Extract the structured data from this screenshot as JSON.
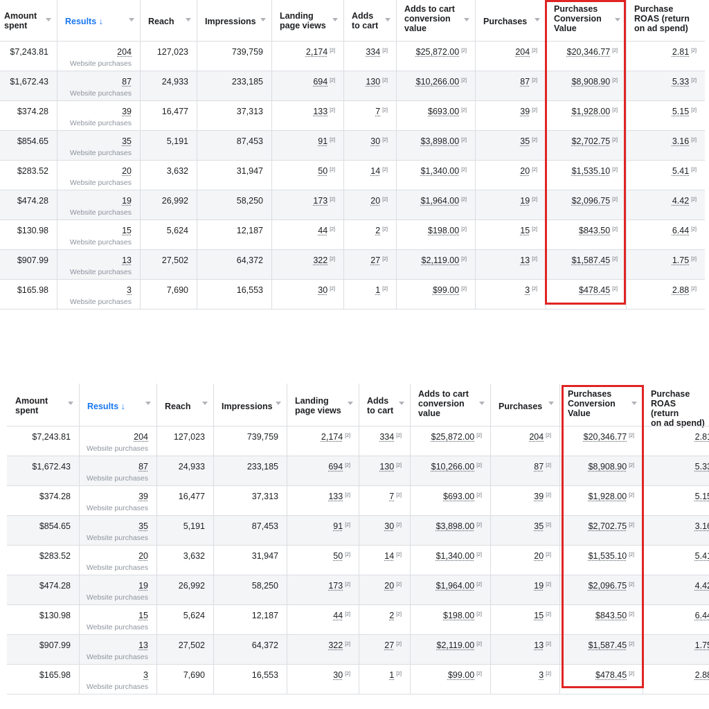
{
  "columns": [
    {
      "key": "amount",
      "label_lines": [
        "Amount",
        "spent"
      ]
    },
    {
      "key": "results",
      "label_lines": [
        "Results ↓"
      ]
    },
    {
      "key": "reach",
      "label_lines": [
        "Reach"
      ]
    },
    {
      "key": "impressions",
      "label_lines": [
        "Impressions"
      ]
    },
    {
      "key": "landing",
      "label_lines": [
        "Landing",
        "page views"
      ]
    },
    {
      "key": "atc",
      "label_lines": [
        "Adds",
        "to cart"
      ]
    },
    {
      "key": "atcv",
      "label_lines": [
        "Adds to cart",
        "conversion",
        "value"
      ]
    },
    {
      "key": "purchases",
      "label_lines": [
        "Purchases"
      ]
    },
    {
      "key": "pcv",
      "label_lines": [
        "Purchases",
        "Conversion",
        "Value"
      ]
    },
    {
      "key": "roas",
      "label_lines": [
        "Purchase",
        "ROAS (return",
        "on ad spend)"
      ]
    }
  ],
  "results_sublabel": "Website purchases",
  "footnote_marker": "[2]",
  "rows": [
    {
      "amount": "$7,243.81",
      "results": "204",
      "reach": "127,023",
      "impressions": "739,759",
      "landing": "2,174",
      "atc": "334",
      "atcv": "$25,872.00",
      "purchases": "204",
      "pcv": "$20,346.77",
      "roas": "2.81"
    },
    {
      "amount": "$1,672.43",
      "results": "87",
      "reach": "24,933",
      "impressions": "233,185",
      "landing": "694",
      "atc": "130",
      "atcv": "$10,266.00",
      "purchases": "87",
      "pcv": "$8,908.90",
      "roas": "5.33"
    },
    {
      "amount": "$374.28",
      "results": "39",
      "reach": "16,477",
      "impressions": "37,313",
      "landing": "133",
      "atc": "7",
      "atcv": "$693.00",
      "purchases": "39",
      "pcv": "$1,928.00",
      "roas": "5.15"
    },
    {
      "amount": "$854.65",
      "results": "35",
      "reach": "5,191",
      "impressions": "87,453",
      "landing": "91",
      "atc": "30",
      "atcv": "$3,898.00",
      "purchases": "35",
      "pcv": "$2,702.75",
      "roas": "3.16"
    },
    {
      "amount": "$283.52",
      "results": "20",
      "reach": "3,632",
      "impressions": "31,947",
      "landing": "50",
      "atc": "14",
      "atcv": "$1,340.00",
      "purchases": "20",
      "pcv": "$1,535.10",
      "roas": "5.41"
    },
    {
      "amount": "$474.28",
      "results": "19",
      "reach": "26,992",
      "impressions": "58,250",
      "landing": "173",
      "atc": "20",
      "atcv": "$1,964.00",
      "purchases": "19",
      "pcv": "$2,096.75",
      "roas": "4.42"
    },
    {
      "amount": "$130.98",
      "results": "15",
      "reach": "5,624",
      "impressions": "12,187",
      "landing": "44",
      "atc": "2",
      "atcv": "$198.00",
      "purchases": "15",
      "pcv": "$843.50",
      "roas": "6.44"
    },
    {
      "amount": "$907.99",
      "results": "13",
      "reach": "27,502",
      "impressions": "64,372",
      "landing": "322",
      "atc": "27",
      "atcv": "$2,119.00",
      "purchases": "13",
      "pcv": "$1,587.45",
      "roas": "1.75"
    },
    {
      "amount": "$165.98",
      "results": "3",
      "reach": "7,690",
      "impressions": "16,553",
      "landing": "30",
      "atc": "1",
      "atcv": "$99.00",
      "purchases": "3",
      "pcv": "$478.45",
      "roas": "2.88"
    }
  ],
  "colors": {
    "accent": "#1877f2",
    "highlight": "#e02424",
    "alt_row": "#f4f5f7",
    "grid": "#dadde1"
  }
}
